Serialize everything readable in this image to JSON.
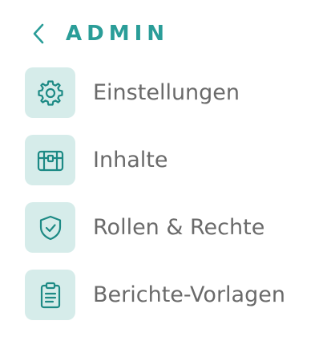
{
  "header": {
    "back_icon": "chevron-left-icon",
    "title": "ADMIN",
    "accent_color": "#2a9d98"
  },
  "menu": {
    "items": [
      {
        "label": "Einstellungen",
        "icon": "gear-icon"
      },
      {
        "label": "Inhalte",
        "icon": "treasure-chest-icon"
      },
      {
        "label": "Rollen & Rechte",
        "icon": "shield-check-icon"
      },
      {
        "label": "Berichte-Vorlagen",
        "icon": "clipboard-icon"
      }
    ],
    "icon_bg_color": "#d6ecea",
    "label_color": "#6a6a6a"
  }
}
